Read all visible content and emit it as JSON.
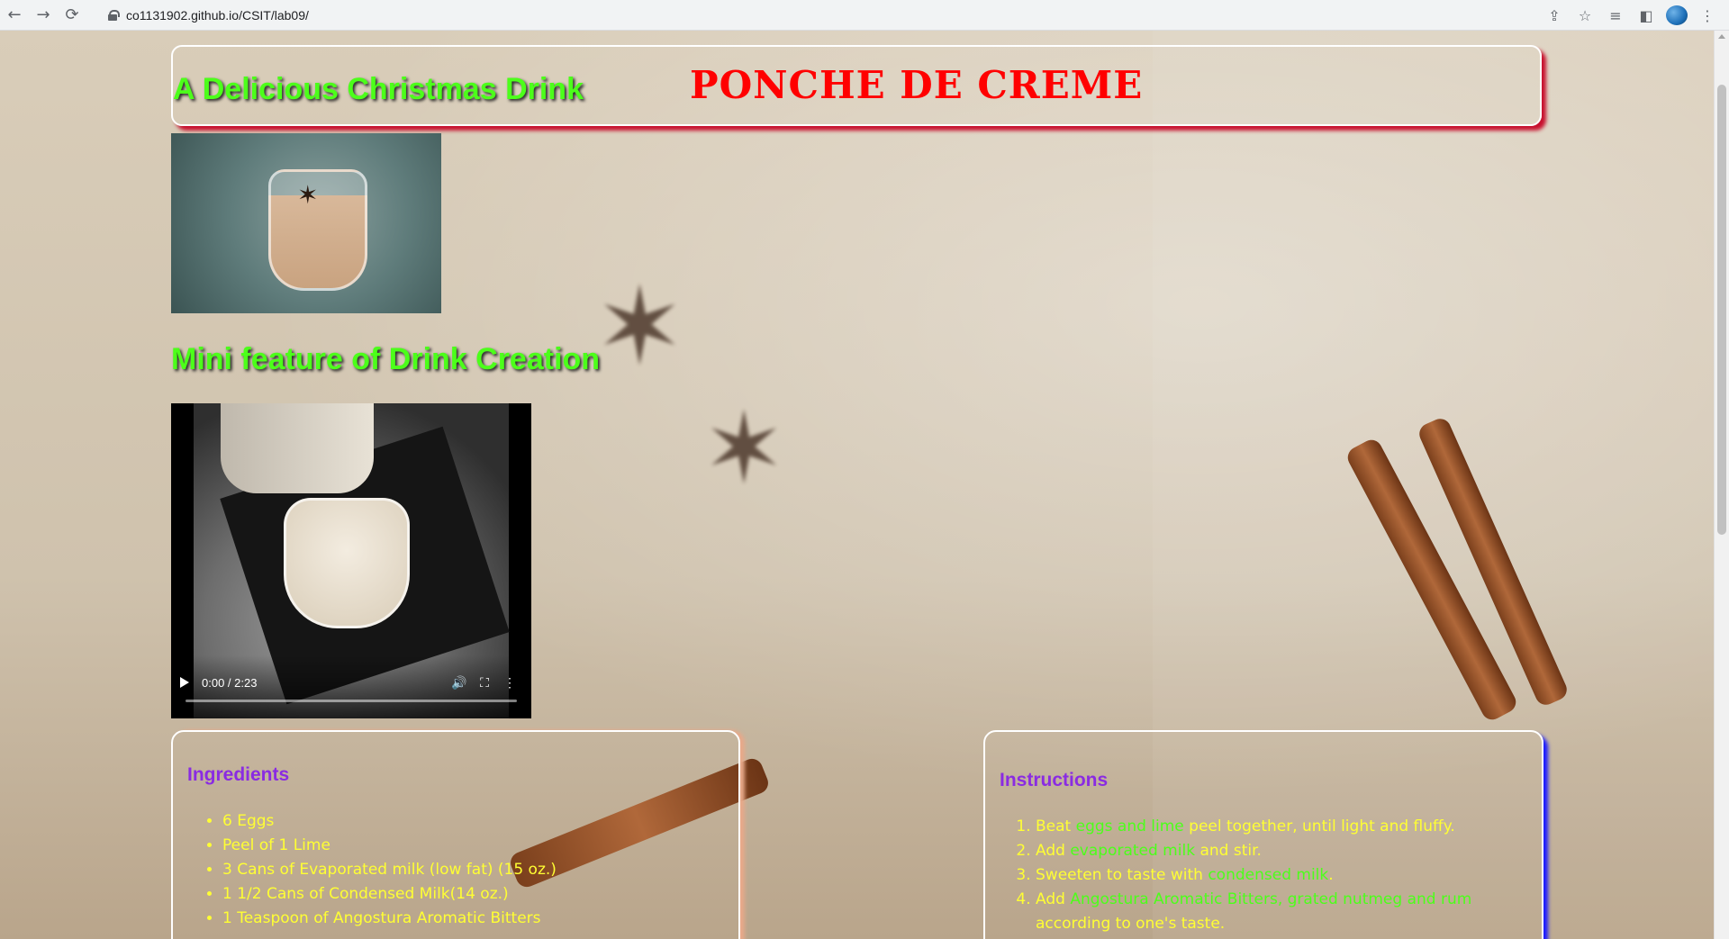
{
  "browser": {
    "url": "co1131902.github.io/CSIT/lab09/"
  },
  "header": {
    "title_left": "A Delicious Christmas Drink",
    "title_right": "PONCHE DE CREME"
  },
  "feature_title": "Mini feature of Drink Creation",
  "video": {
    "time": "0:00 / 2:23"
  },
  "ingredients": {
    "title": "Ingredients",
    "items": [
      "6 Eggs",
      "Peel of 1 Lime",
      "3 Cans of Evaporated milk (low fat) (15 oz.)",
      "1 1/2 Cans of Condensed Milk(14 oz.)",
      "1 Teaspoon of Angostura Aromatic Bitters"
    ]
  },
  "instructions": {
    "title": "Instructions",
    "steps": [
      {
        "pre": "Beat ",
        "hl": "eggs and lime",
        "post": " peel together, until light and fluffy."
      },
      {
        "pre": "Add ",
        "hl": "evaporated milk",
        "post": " and stir."
      },
      {
        "pre": "Sweeten to taste with ",
        "hl": "condensed milk",
        "post": "."
      },
      {
        "pre": "Add ",
        "hl": "Angostura Aromatic Bitters, grated nutmeg and rum",
        "post": " according to one's taste."
      }
    ]
  },
  "colors": {
    "title_green": "#4cff1a",
    "title_red": "#ff0000",
    "panel_title_purple": "#8a2be2",
    "list_yellow": "#ffff33"
  }
}
